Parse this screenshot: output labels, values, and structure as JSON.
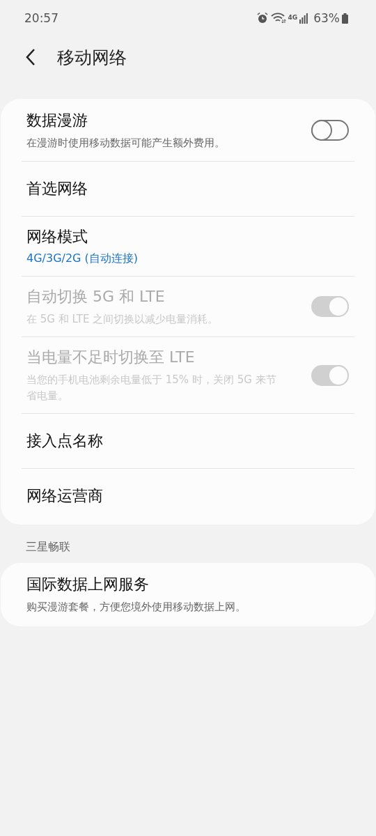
{
  "status_bar": {
    "time": "20:57",
    "network_type": "4G",
    "battery": "63%"
  },
  "header": {
    "title": "移动网络"
  },
  "groups": [
    {
      "items": [
        {
          "kind": "toggle",
          "title": "数据漫游",
          "subtitle": "在漫游时使用移动数据可能产生额外费用。",
          "on": false,
          "disabled": false
        },
        {
          "kind": "plain",
          "title": "首选网络"
        },
        {
          "kind": "value",
          "title": "网络模式",
          "value": "4G/3G/2G (自动连接)"
        },
        {
          "kind": "toggle",
          "title": "自动切换 5G 和 LTE",
          "subtitle": "在 5G 和 LTE 之间切换以减少电量消耗。",
          "on": true,
          "disabled": true
        },
        {
          "kind": "toggle",
          "title": "当电量不足时切换至 LTE",
          "subtitle": "当您的手机电池剩余电量低于 15% 时，关闭 5G 来节省电量。",
          "on": true,
          "disabled": true
        },
        {
          "kind": "plain",
          "title": "接入点名称"
        },
        {
          "kind": "plain",
          "title": "网络运营商"
        }
      ]
    },
    {
      "header": "三星畅联",
      "items": [
        {
          "kind": "plain",
          "title": "国际数据上网服务",
          "subtitle": "购买漫游套餐，方便您境外使用移动数据上网。"
        }
      ]
    }
  ]
}
